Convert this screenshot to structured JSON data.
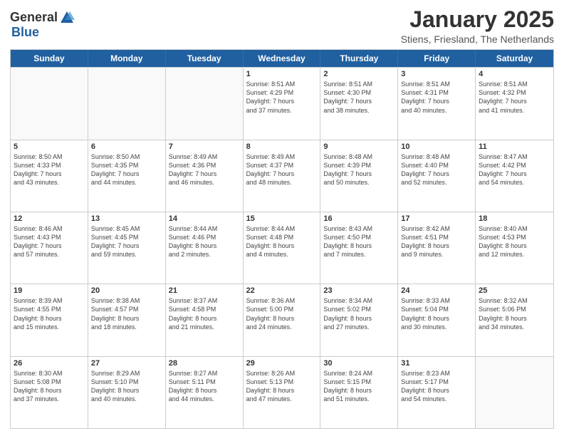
{
  "header": {
    "logo_general": "General",
    "logo_blue": "Blue",
    "month": "January 2025",
    "location": "Stiens, Friesland, The Netherlands"
  },
  "day_headers": [
    "Sunday",
    "Monday",
    "Tuesday",
    "Wednesday",
    "Thursday",
    "Friday",
    "Saturday"
  ],
  "weeks": [
    [
      {
        "day": "",
        "info": ""
      },
      {
        "day": "",
        "info": ""
      },
      {
        "day": "",
        "info": ""
      },
      {
        "day": "1",
        "info": "Sunrise: 8:51 AM\nSunset: 4:29 PM\nDaylight: 7 hours\nand 37 minutes."
      },
      {
        "day": "2",
        "info": "Sunrise: 8:51 AM\nSunset: 4:30 PM\nDaylight: 7 hours\nand 38 minutes."
      },
      {
        "day": "3",
        "info": "Sunrise: 8:51 AM\nSunset: 4:31 PM\nDaylight: 7 hours\nand 40 minutes."
      },
      {
        "day": "4",
        "info": "Sunrise: 8:51 AM\nSunset: 4:32 PM\nDaylight: 7 hours\nand 41 minutes."
      }
    ],
    [
      {
        "day": "5",
        "info": "Sunrise: 8:50 AM\nSunset: 4:33 PM\nDaylight: 7 hours\nand 43 minutes."
      },
      {
        "day": "6",
        "info": "Sunrise: 8:50 AM\nSunset: 4:35 PM\nDaylight: 7 hours\nand 44 minutes."
      },
      {
        "day": "7",
        "info": "Sunrise: 8:49 AM\nSunset: 4:36 PM\nDaylight: 7 hours\nand 46 minutes."
      },
      {
        "day": "8",
        "info": "Sunrise: 8:49 AM\nSunset: 4:37 PM\nDaylight: 7 hours\nand 48 minutes."
      },
      {
        "day": "9",
        "info": "Sunrise: 8:48 AM\nSunset: 4:39 PM\nDaylight: 7 hours\nand 50 minutes."
      },
      {
        "day": "10",
        "info": "Sunrise: 8:48 AM\nSunset: 4:40 PM\nDaylight: 7 hours\nand 52 minutes."
      },
      {
        "day": "11",
        "info": "Sunrise: 8:47 AM\nSunset: 4:42 PM\nDaylight: 7 hours\nand 54 minutes."
      }
    ],
    [
      {
        "day": "12",
        "info": "Sunrise: 8:46 AM\nSunset: 4:43 PM\nDaylight: 7 hours\nand 57 minutes."
      },
      {
        "day": "13",
        "info": "Sunrise: 8:45 AM\nSunset: 4:45 PM\nDaylight: 7 hours\nand 59 minutes."
      },
      {
        "day": "14",
        "info": "Sunrise: 8:44 AM\nSunset: 4:46 PM\nDaylight: 8 hours\nand 2 minutes."
      },
      {
        "day": "15",
        "info": "Sunrise: 8:44 AM\nSunset: 4:48 PM\nDaylight: 8 hours\nand 4 minutes."
      },
      {
        "day": "16",
        "info": "Sunrise: 8:43 AM\nSunset: 4:50 PM\nDaylight: 8 hours\nand 7 minutes."
      },
      {
        "day": "17",
        "info": "Sunrise: 8:42 AM\nSunset: 4:51 PM\nDaylight: 8 hours\nand 9 minutes."
      },
      {
        "day": "18",
        "info": "Sunrise: 8:40 AM\nSunset: 4:53 PM\nDaylight: 8 hours\nand 12 minutes."
      }
    ],
    [
      {
        "day": "19",
        "info": "Sunrise: 8:39 AM\nSunset: 4:55 PM\nDaylight: 8 hours\nand 15 minutes."
      },
      {
        "day": "20",
        "info": "Sunrise: 8:38 AM\nSunset: 4:57 PM\nDaylight: 8 hours\nand 18 minutes."
      },
      {
        "day": "21",
        "info": "Sunrise: 8:37 AM\nSunset: 4:58 PM\nDaylight: 8 hours\nand 21 minutes."
      },
      {
        "day": "22",
        "info": "Sunrise: 8:36 AM\nSunset: 5:00 PM\nDaylight: 8 hours\nand 24 minutes."
      },
      {
        "day": "23",
        "info": "Sunrise: 8:34 AM\nSunset: 5:02 PM\nDaylight: 8 hours\nand 27 minutes."
      },
      {
        "day": "24",
        "info": "Sunrise: 8:33 AM\nSunset: 5:04 PM\nDaylight: 8 hours\nand 30 minutes."
      },
      {
        "day": "25",
        "info": "Sunrise: 8:32 AM\nSunset: 5:06 PM\nDaylight: 8 hours\nand 34 minutes."
      }
    ],
    [
      {
        "day": "26",
        "info": "Sunrise: 8:30 AM\nSunset: 5:08 PM\nDaylight: 8 hours\nand 37 minutes."
      },
      {
        "day": "27",
        "info": "Sunrise: 8:29 AM\nSunset: 5:10 PM\nDaylight: 8 hours\nand 40 minutes."
      },
      {
        "day": "28",
        "info": "Sunrise: 8:27 AM\nSunset: 5:11 PM\nDaylight: 8 hours\nand 44 minutes."
      },
      {
        "day": "29",
        "info": "Sunrise: 8:26 AM\nSunset: 5:13 PM\nDaylight: 8 hours\nand 47 minutes."
      },
      {
        "day": "30",
        "info": "Sunrise: 8:24 AM\nSunset: 5:15 PM\nDaylight: 8 hours\nand 51 minutes."
      },
      {
        "day": "31",
        "info": "Sunrise: 8:23 AM\nSunset: 5:17 PM\nDaylight: 8 hours\nand 54 minutes."
      },
      {
        "day": "",
        "info": ""
      }
    ]
  ]
}
